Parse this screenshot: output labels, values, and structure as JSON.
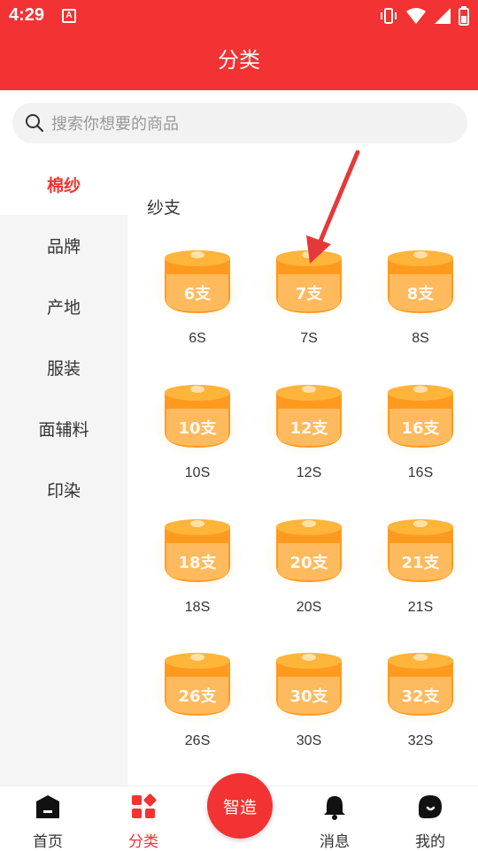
{
  "status": {
    "time": "4:29",
    "notif_glyph": "A"
  },
  "header": {
    "title": "分类"
  },
  "search": {
    "placeholder": "搜索你想要的商品"
  },
  "sidebar": {
    "items": [
      {
        "label": "棉纱",
        "active": true
      },
      {
        "label": "品牌",
        "active": false
      },
      {
        "label": "产地",
        "active": false
      },
      {
        "label": "服装",
        "active": false
      },
      {
        "label": "面辅料",
        "active": false
      },
      {
        "label": "印染",
        "active": false
      }
    ]
  },
  "section": {
    "title": "纱支"
  },
  "products": [
    {
      "spool_text": "6支",
      "label": "6S"
    },
    {
      "spool_text": "7支",
      "label": "7S"
    },
    {
      "spool_text": "8支",
      "label": "8S"
    },
    {
      "spool_text": "10支",
      "label": "10S"
    },
    {
      "spool_text": "12支",
      "label": "12S"
    },
    {
      "spool_text": "16支",
      "label": "16S"
    },
    {
      "spool_text": "18支",
      "label": "18S"
    },
    {
      "spool_text": "20支",
      "label": "20S"
    },
    {
      "spool_text": "21支",
      "label": "21S"
    },
    {
      "spool_text": "26支",
      "label": "26S"
    },
    {
      "spool_text": "30支",
      "label": "30S"
    },
    {
      "spool_text": "32支",
      "label": "32S"
    }
  ],
  "tabbar": {
    "tabs": [
      {
        "label": "首页",
        "icon": "home-icon",
        "active": false
      },
      {
        "label": "分类",
        "icon": "category-icon",
        "active": true
      },
      {
        "label": "消息",
        "icon": "bell-icon",
        "active": false
      },
      {
        "label": "我的",
        "icon": "profile-icon",
        "active": false
      }
    ],
    "center_label": "智造"
  },
  "colors": {
    "brand": "#f23233",
    "spool_orange": "#ff9a1f",
    "spool_light": "#ffc06a"
  }
}
